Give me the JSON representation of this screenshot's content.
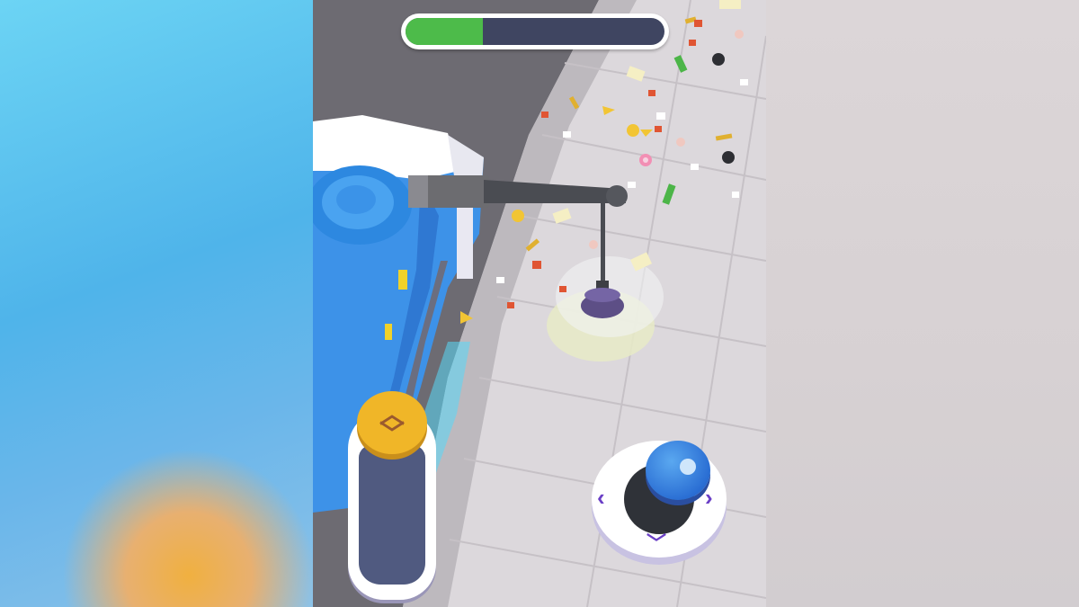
{
  "hud": {
    "progress": 0.3,
    "colors": {
      "fill": "#4dbb4a",
      "track": "#3f4561",
      "frame": "#ffffff"
    }
  },
  "controls": {
    "slider": {
      "icon": "chevron-up-down-icon",
      "knob_color": "#f0b628"
    },
    "joystick": {
      "knob_color": "#2b6fd4",
      "arrow_color": "#6a3fc6",
      "arrows": [
        "chevron-left-icon",
        "chevron-right-icon",
        "chevron-down-icon"
      ]
    }
  },
  "scene": {
    "vehicle": "street-sweeper-truck",
    "vehicle_color": "#3d92e8",
    "tool": "sweeper-brush",
    "litter": [
      "bottle",
      "ball",
      "paper",
      "cheese",
      "can",
      "donut",
      "candy",
      "cup"
    ]
  }
}
